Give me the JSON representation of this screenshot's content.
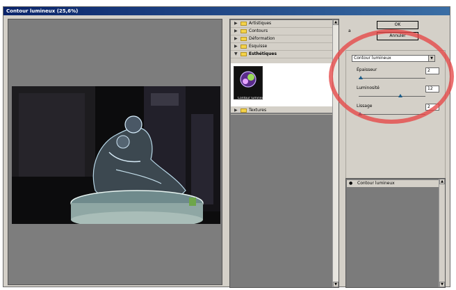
{
  "window": {
    "title": "Contour lumineux (25,6%)"
  },
  "filter_list": {
    "categories": [
      {
        "label": "Artistiques",
        "expanded": false
      },
      {
        "label": "Contours",
        "expanded": false
      },
      {
        "label": "Déformation",
        "expanded": false
      },
      {
        "label": "Esquisse",
        "expanded": false
      },
      {
        "label": "Esthétiques",
        "expanded": true
      },
      {
        "label": "Textures",
        "expanded": false
      }
    ],
    "selected_filter": "Contour lumineux"
  },
  "buttons": {
    "ok": "OK",
    "cancel": "Annuler"
  },
  "marker": "a",
  "params": {
    "filter_select": "Contour lumineux",
    "items": [
      {
        "label": "Épaisseur",
        "value": "2",
        "level": 0.03
      },
      {
        "label": "Luminosité",
        "value": "12",
        "level": 0.6
      },
      {
        "label": "Lissage",
        "value": "2",
        "level": 0.02
      }
    ]
  },
  "layers": {
    "item": "Contour lumineux"
  },
  "colors": {
    "titlebar_start": "#0a246a",
    "titlebar_end": "#3a6ea5",
    "annotation_circle": "#e64646"
  }
}
